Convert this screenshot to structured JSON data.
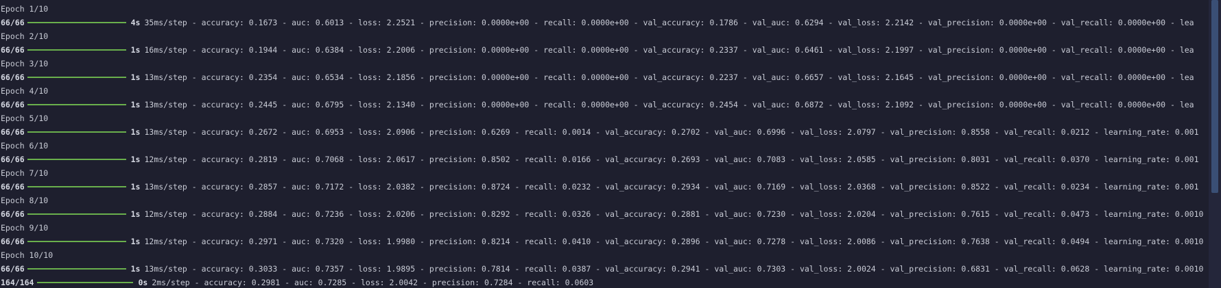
{
  "console": {
    "epochs": [
      {
        "label": "Epoch 1/10",
        "step": "66/66",
        "time": "4s",
        "metrics": "35ms/step - accuracy: 0.1673 - auc: 0.6013 - loss: 2.2521 - precision: 0.0000e+00 - recall: 0.0000e+00 - val_accuracy: 0.1786 - val_auc: 0.6294 - val_loss: 2.2142 - val_precision: 0.0000e+00 - val_recall: 0.0000e+00 - lea"
      },
      {
        "label": "Epoch 2/10",
        "step": "66/66",
        "time": "1s",
        "metrics": "16ms/step - accuracy: 0.1944 - auc: 0.6384 - loss: 2.2006 - precision: 0.0000e+00 - recall: 0.0000e+00 - val_accuracy: 0.2337 - val_auc: 0.6461 - val_loss: 2.1997 - val_precision: 0.0000e+00 - val_recall: 0.0000e+00 - lea"
      },
      {
        "label": "Epoch 3/10",
        "step": "66/66",
        "time": "1s",
        "metrics": "13ms/step - accuracy: 0.2354 - auc: 0.6534 - loss: 2.1856 - precision: 0.0000e+00 - recall: 0.0000e+00 - val_accuracy: 0.2237 - val_auc: 0.6657 - val_loss: 2.1645 - val_precision: 0.0000e+00 - val_recall: 0.0000e+00 - lea"
      },
      {
        "label": "Epoch 4/10",
        "step": "66/66",
        "time": "1s",
        "metrics": "13ms/step - accuracy: 0.2445 - auc: 0.6795 - loss: 2.1340 - precision: 0.0000e+00 - recall: 0.0000e+00 - val_accuracy: 0.2454 - val_auc: 0.6872 - val_loss: 2.1092 - val_precision: 0.0000e+00 - val_recall: 0.0000e+00 - lea"
      },
      {
        "label": "Epoch 5/10",
        "step": "66/66",
        "time": "1s",
        "metrics": "13ms/step - accuracy: 0.2672 - auc: 0.6953 - loss: 2.0906 - precision: 0.6269 - recall: 0.0014 - val_accuracy: 0.2702 - val_auc: 0.6996 - val_loss: 2.0797 - val_precision: 0.8558 - val_recall: 0.0212 - learning_rate: 0.001"
      },
      {
        "label": "Epoch 6/10",
        "step": "66/66",
        "time": "1s",
        "metrics": "12ms/step - accuracy: 0.2819 - auc: 0.7068 - loss: 2.0617 - precision: 0.8502 - recall: 0.0166 - val_accuracy: 0.2693 - val_auc: 0.7083 - val_loss: 2.0585 - val_precision: 0.8031 - val_recall: 0.0370 - learning_rate: 0.001"
      },
      {
        "label": "Epoch 7/10",
        "step": "66/66",
        "time": "1s",
        "metrics": "13ms/step - accuracy: 0.2857 - auc: 0.7172 - loss: 2.0382 - precision: 0.8724 - recall: 0.0232 - val_accuracy: 0.2934 - val_auc: 0.7169 - val_loss: 2.0368 - val_precision: 0.8522 - val_recall: 0.0234 - learning_rate: 0.001"
      },
      {
        "label": "Epoch 8/10",
        "step": "66/66",
        "time": "1s",
        "metrics": "12ms/step - accuracy: 0.2884 - auc: 0.7236 - loss: 2.0206 - precision: 0.8292 - recall: 0.0326 - val_accuracy: 0.2881 - val_auc: 0.7230 - val_loss: 2.0204 - val_precision: 0.7615 - val_recall: 0.0473 - learning_rate: 0.0010"
      },
      {
        "label": "Epoch 9/10",
        "step": "66/66",
        "time": "1s",
        "metrics": "12ms/step - accuracy: 0.2971 - auc: 0.7320 - loss: 1.9980 - precision: 0.8214 - recall: 0.0410 - val_accuracy: 0.2896 - val_auc: 0.7278 - val_loss: 2.0086 - val_precision: 0.7638 - val_recall: 0.0494 - learning_rate: 0.0010"
      },
      {
        "label": "Epoch 10/10",
        "step": "66/66",
        "time": "1s",
        "metrics": "13ms/step - accuracy: 0.3033 - auc: 0.7357 - loss: 1.9895 - precision: 0.7814 - recall: 0.0387 - val_accuracy: 0.2941 - val_auc: 0.7303 - val_loss: 2.0024 - val_precision: 0.6831 - val_recall: 0.0628 - learning_rate: 0.0010"
      }
    ],
    "evaluation": {
      "step": "164/164",
      "time": "0s",
      "metrics": "2ms/step - accuracy: 0.2981 - auc: 0.7285 - loss: 2.0042 - precision: 0.7284 - recall: 0.0603"
    }
  },
  "colors": {
    "background": "#1e1f2e",
    "text": "#c9ccd6",
    "progress_bar": "#6ab04c",
    "scrollbar_thumb": "#3a4f75"
  }
}
